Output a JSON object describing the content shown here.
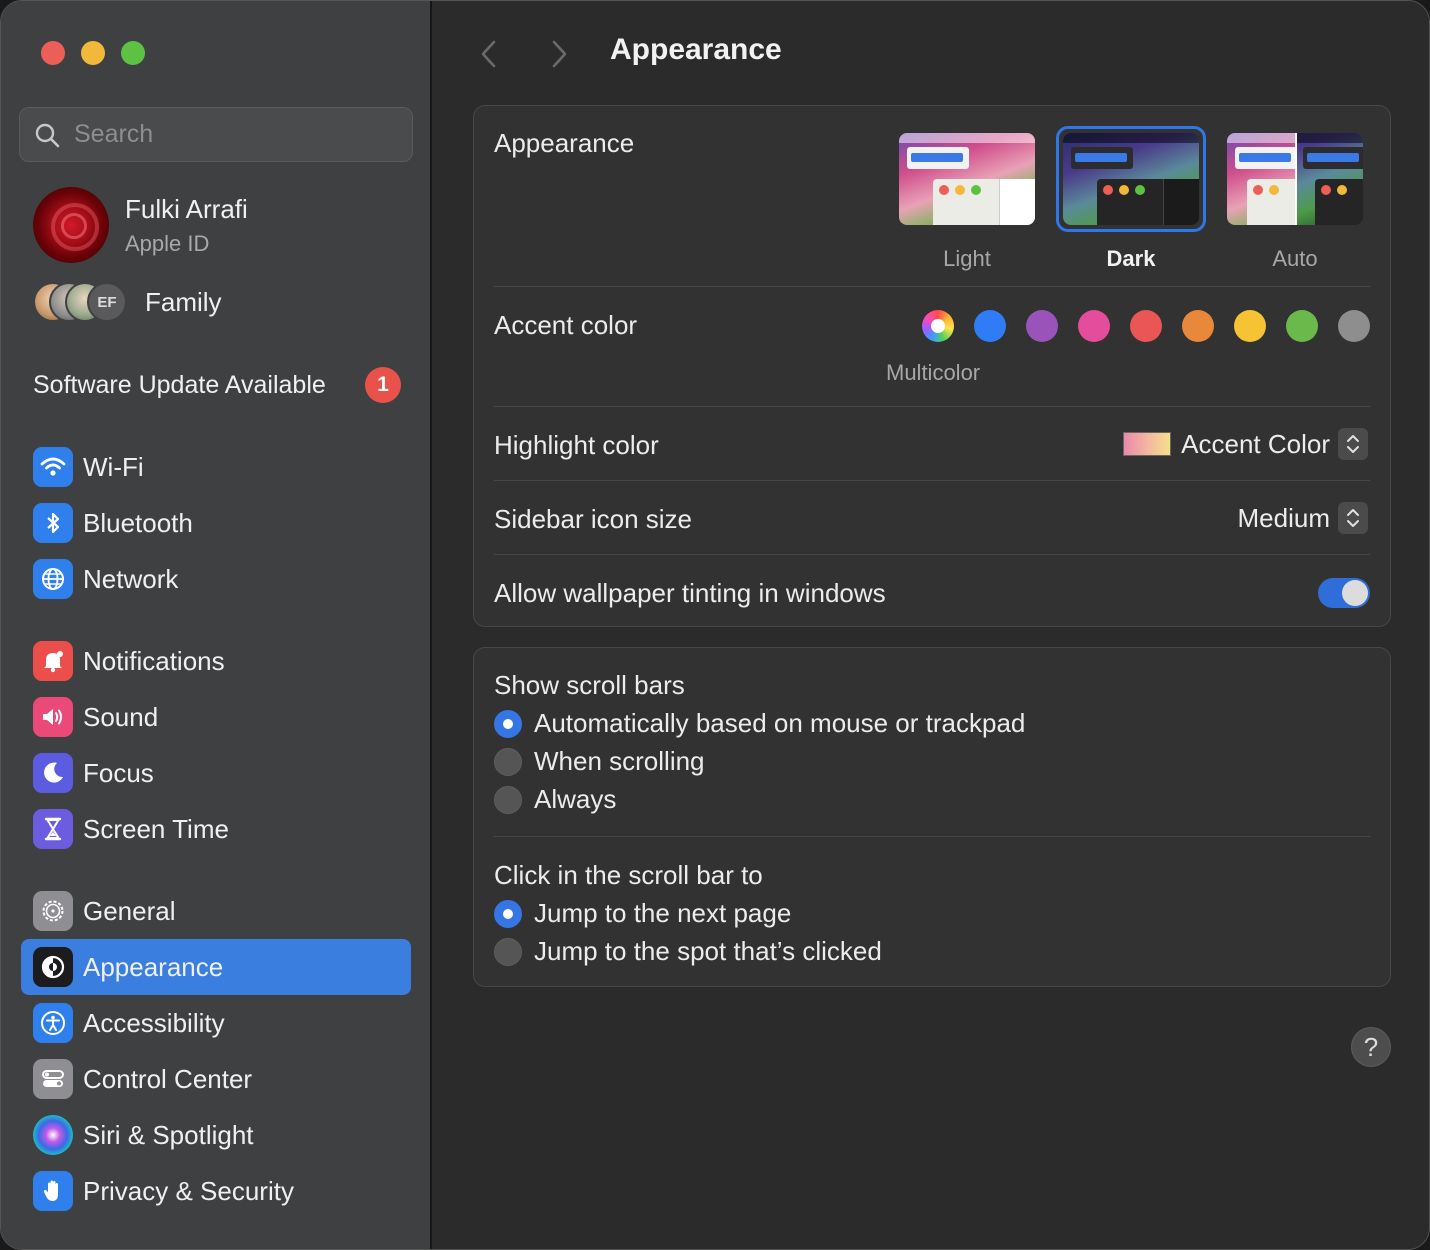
{
  "window": {
    "traffic_lights": {
      "close": "#ec5f56",
      "minimize": "#f2b83a",
      "zoom": "#5dc244"
    }
  },
  "sidebar": {
    "search_placeholder": "Search",
    "profile": {
      "name": "Fulki Arrafi",
      "subtitle": "Apple ID"
    },
    "family": {
      "initials": "EF",
      "label": "Family"
    },
    "update": {
      "label": "Software Update Available",
      "count": "1"
    },
    "items": [
      {
        "label": "Wi-Fi",
        "icon": "wifi-icon",
        "color": "#2f80ed"
      },
      {
        "label": "Bluetooth",
        "icon": "bluetooth-icon",
        "color": "#2f80ed"
      },
      {
        "label": "Network",
        "icon": "globe-icon",
        "color": "#2f80ed"
      },
      {
        "label": "Notifications",
        "icon": "bell-icon",
        "color": "#eb4e4b"
      },
      {
        "label": "Sound",
        "icon": "speaker-icon",
        "color": "#eb4a78"
      },
      {
        "label": "Focus",
        "icon": "moon-icon",
        "color": "#5b5ce0"
      },
      {
        "label": "Screen Time",
        "icon": "hourglass-icon",
        "color": "#6c5ce0"
      },
      {
        "label": "General",
        "icon": "gear-icon",
        "color": "#8e8e93"
      },
      {
        "label": "Appearance",
        "icon": "appearance-icon",
        "color": "#1c1c1e"
      },
      {
        "label": "Accessibility",
        "icon": "accessibility-icon",
        "color": "#2f80ed"
      },
      {
        "label": "Control Center",
        "icon": "control-center-icon",
        "color": "#8e8e93"
      },
      {
        "label": "Siri & Spotlight",
        "icon": "siri-icon",
        "color": "#2a2a4a"
      },
      {
        "label": "Privacy & Security",
        "icon": "hand-icon",
        "color": "#2f80ed"
      }
    ],
    "active": "Appearance"
  },
  "main": {
    "title": "Appearance",
    "appearance": {
      "label": "Appearance",
      "options": [
        {
          "label": "Light",
          "selected": false
        },
        {
          "label": "Dark",
          "selected": true
        },
        {
          "label": "Auto",
          "selected": false
        }
      ]
    },
    "accent": {
      "label": "Accent color",
      "selected_caption": "Multicolor",
      "colors": [
        "multicolor",
        "#2f7cf6",
        "#9a53b8",
        "#e34d9b",
        "#ea5656",
        "#e9883a",
        "#f5c333",
        "#6bb84b",
        "#8e8e8e"
      ]
    },
    "highlight": {
      "label": "Highlight color",
      "value": "Accent Color"
    },
    "sidebar_icon_size": {
      "label": "Sidebar icon size",
      "value": "Medium"
    },
    "wallpaper_tinting": {
      "label": "Allow wallpaper tinting in windows",
      "enabled": true
    },
    "scroll_bars": {
      "title": "Show scroll bars",
      "options": [
        {
          "label": "Automatically based on mouse or trackpad",
          "selected": true
        },
        {
          "label": "When scrolling",
          "selected": false
        },
        {
          "label": "Always",
          "selected": false
        }
      ]
    },
    "scroll_click": {
      "title": "Click in the scroll bar to",
      "options": [
        {
          "label": "Jump to the next page",
          "selected": true
        },
        {
          "label": "Jump to the spot that’s clicked",
          "selected": false
        }
      ]
    },
    "help_label": "?"
  }
}
